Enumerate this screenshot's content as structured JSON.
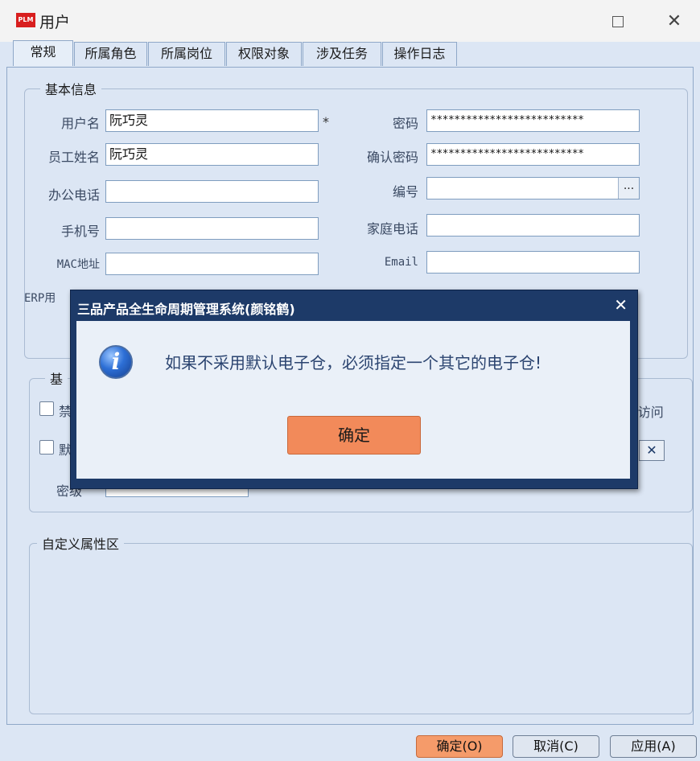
{
  "window": {
    "title": "用户",
    "logo_text": "PLM"
  },
  "tabs": [
    {
      "label": "常规"
    },
    {
      "label": "所属角色"
    },
    {
      "label": "所属岗位"
    },
    {
      "label": "权限对象"
    },
    {
      "label": "涉及任务"
    },
    {
      "label": "操作日志"
    }
  ],
  "basic_info": {
    "title": "基本信息",
    "username_label": "用户名",
    "username_value": "阮巧灵",
    "required_mark": "*",
    "employee_name_label": "员工姓名",
    "employee_name_value": "阮巧灵",
    "office_phone_label": "办公电话",
    "office_phone_value": "",
    "mobile_label": "手机号",
    "mobile_value": "",
    "mac_label": "MAC地址",
    "mac_value": "",
    "erp_label": "ERP用",
    "password_label": "密码",
    "password_value": "**************************",
    "confirm_password_label": "确认密码",
    "confirm_password_value": "**************************",
    "number_label": "编号",
    "number_value": "",
    "number_button": "...",
    "home_phone_label": "家庭电话",
    "home_phone_value": "",
    "email_label": "Email",
    "email_value": ""
  },
  "group2": {
    "title_partial": "基",
    "check1_partial": "禁",
    "check2_partial": "默",
    "right_partial": "I访问",
    "secret_label_partial": "密级",
    "clear_icon": "✕"
  },
  "custom_attr": {
    "title": "自定义属性区"
  },
  "footer": {
    "ok": "确定(O)",
    "cancel": "取消(C)",
    "apply": "应用(A)"
  },
  "dialog": {
    "title": "三品产品全生命周期管理系统(颜铭鹤)",
    "close": "✕",
    "icon": "i",
    "message": "如果不采用默认电子仓，必须指定一个其它的电子仓!",
    "ok": "确定"
  }
}
